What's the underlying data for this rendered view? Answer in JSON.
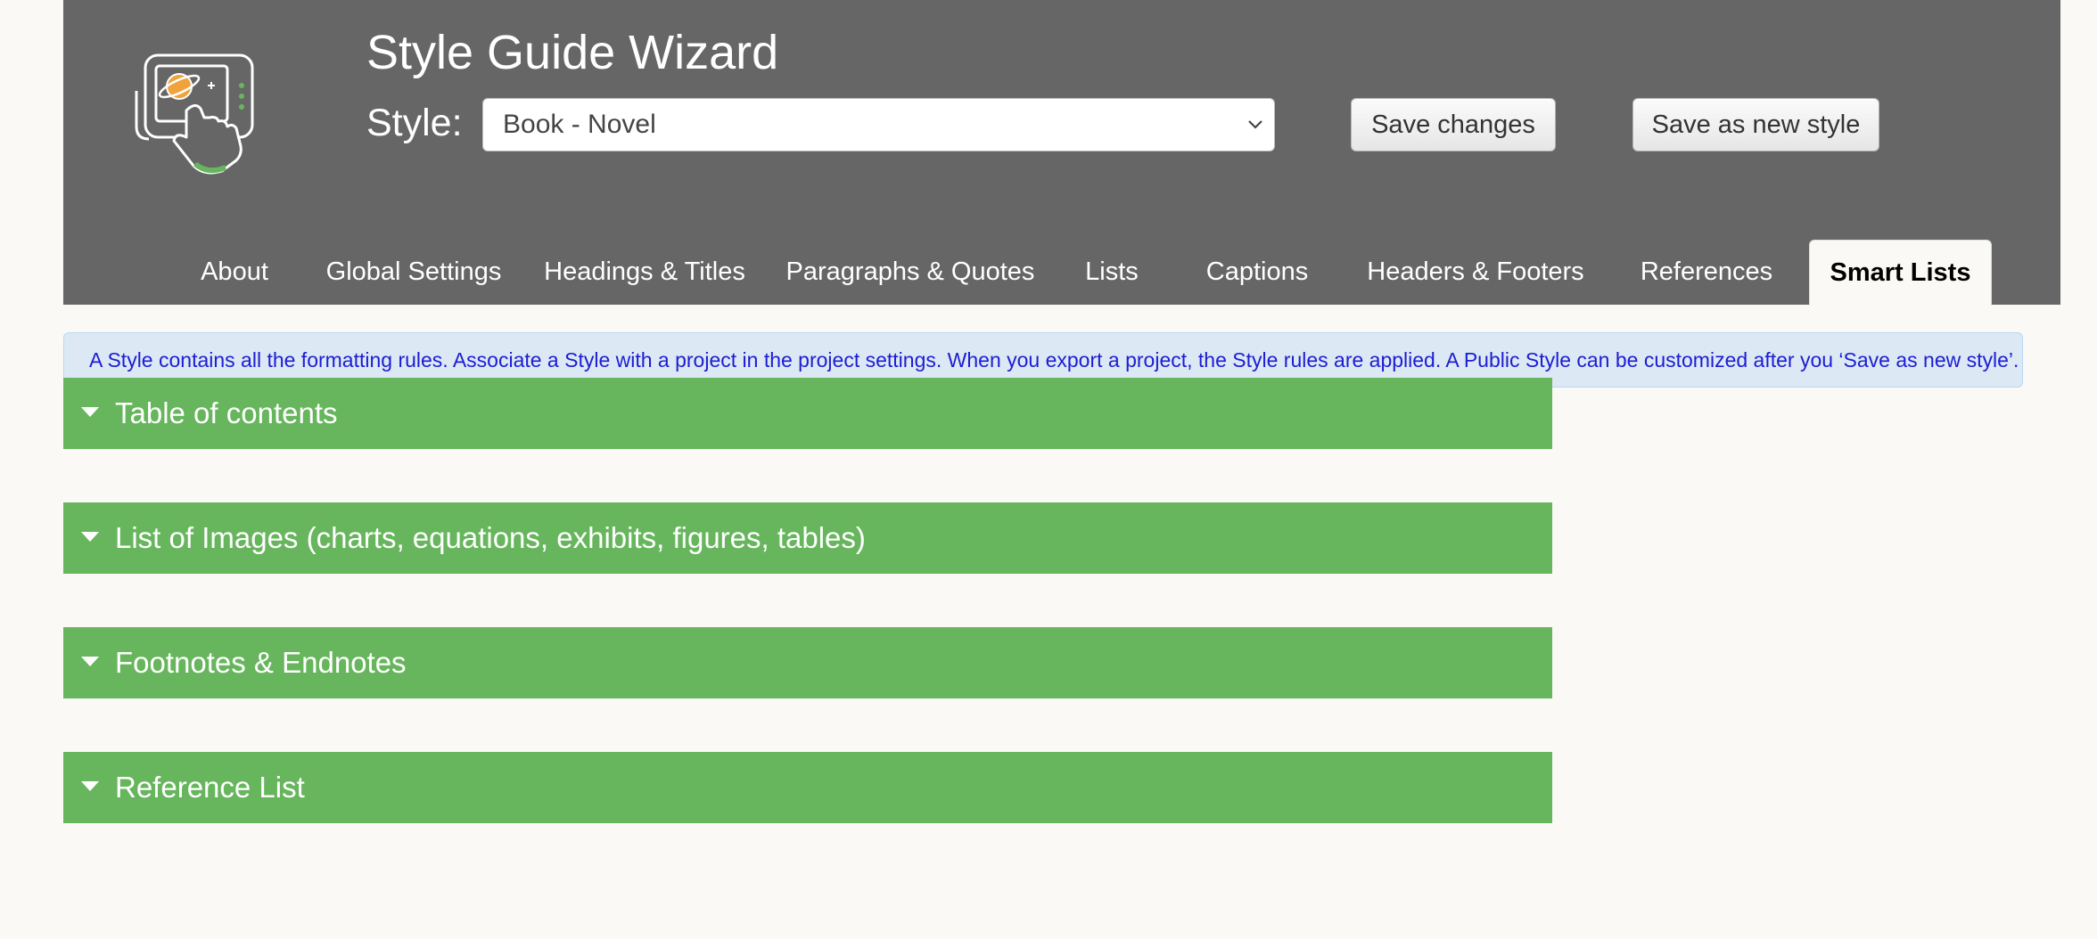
{
  "app": {
    "title": "Style Guide Wizard",
    "logo_icon": "touch-tablet-planet-logo"
  },
  "style_picker": {
    "label": "Style:",
    "selected": "Book - Novel"
  },
  "buttons": {
    "save": "Save changes",
    "save_new": "Save as new style"
  },
  "tabs": [
    {
      "label": "About",
      "active": false
    },
    {
      "label": "Global Settings",
      "active": false
    },
    {
      "label": "Headings & Titles",
      "active": false
    },
    {
      "label": "Paragraphs & Quotes",
      "active": false
    },
    {
      "label": "Lists",
      "active": false
    },
    {
      "label": "Captions",
      "active": false
    },
    {
      "label": "Headers & Footers",
      "active": false
    },
    {
      "label": "References",
      "active": false
    },
    {
      "label": "Smart Lists",
      "active": true
    }
  ],
  "info": "A Style contains all the formatting rules. Associate a Style with a project in the project settings. When you export a project, the Style rules are applied. A Public Style can be customized after you ‘Save as new style’.",
  "sections": [
    {
      "title": "Table of contents",
      "icon": "caret-down-icon"
    },
    {
      "title": "List of Images (charts, equations, exhibits, figures, tables)",
      "icon": "caret-down-icon"
    },
    {
      "title": "Footnotes & Endnotes",
      "icon": "caret-down-icon"
    },
    {
      "title": "Reference List",
      "icon": "caret-down-icon"
    }
  ],
  "colors": {
    "header_bg": "#666666",
    "section_bg": "#67b65d",
    "info_bg": "#dce9f4",
    "info_text": "#1d1dd3",
    "page_bg": "#faf9f5"
  }
}
